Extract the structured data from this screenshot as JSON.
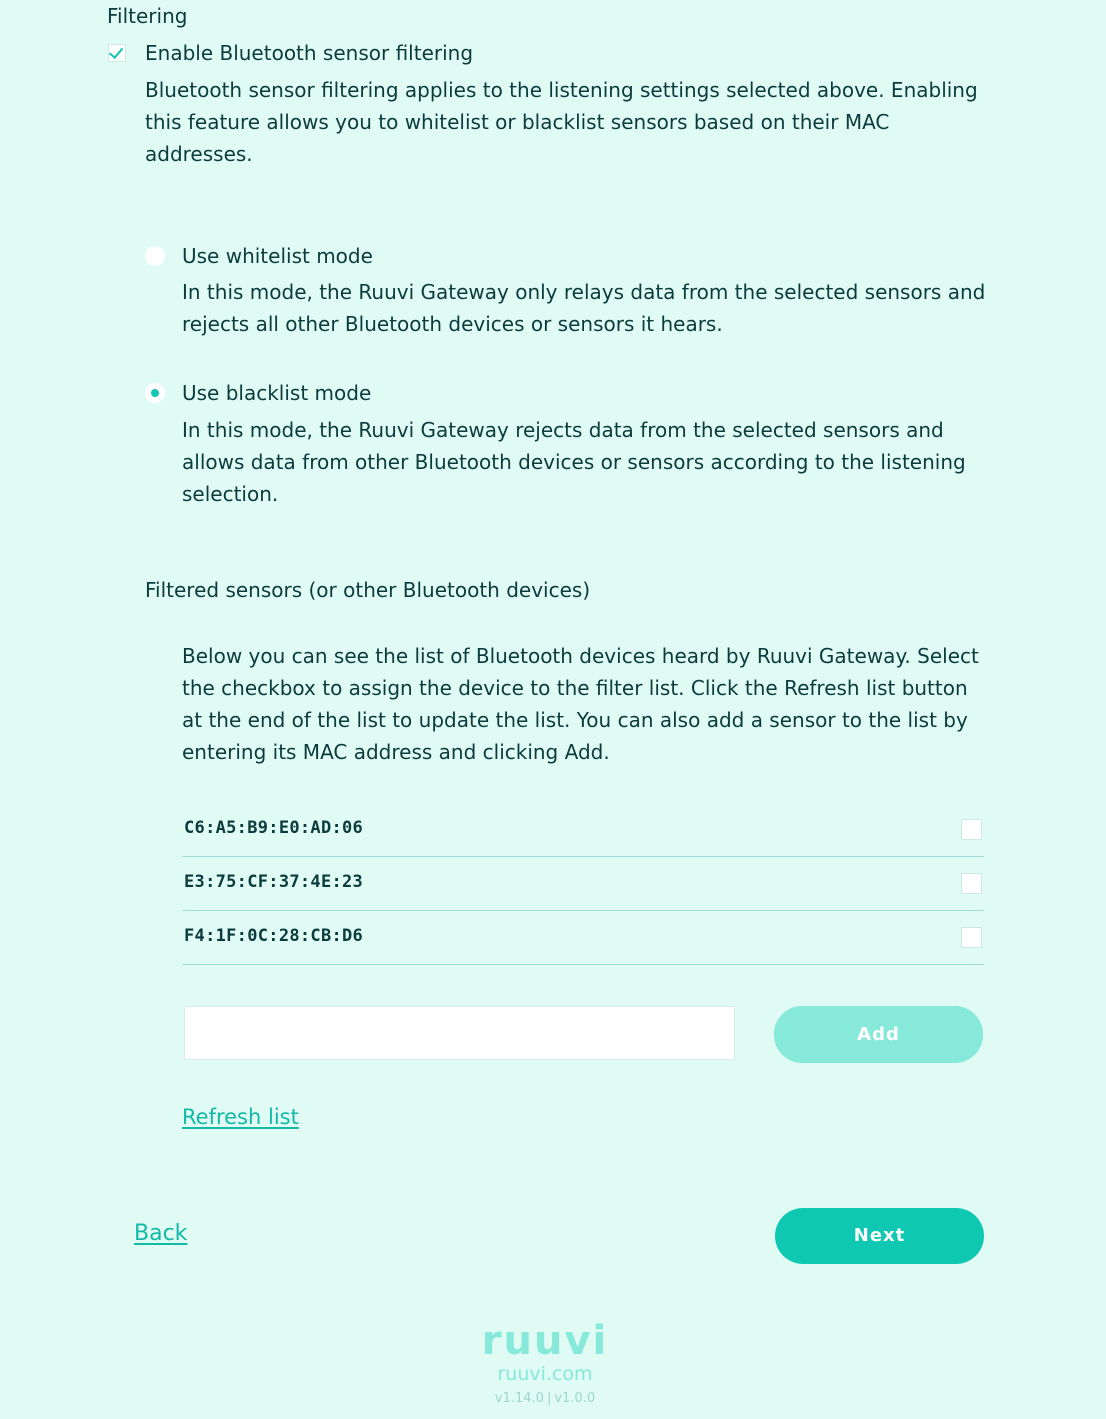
{
  "filtering": {
    "title": "Filtering",
    "enable_label": "Enable Bluetooth sensor filtering",
    "enabled": true,
    "description": "Bluetooth sensor filtering applies to the listening settings selected above. Enabling this feature allows you to whitelist or blacklist sensors based on their MAC addresses."
  },
  "modes": {
    "whitelist": {
      "label": "Use whitelist mode",
      "selected": false,
      "description": "In this mode, the Ruuvi Gateway only relays data from the selected sensors and rejects all other Bluetooth devices or sensors it hears."
    },
    "blacklist": {
      "label": "Use blacklist mode",
      "selected": true,
      "description": "In this mode, the Ruuvi Gateway rejects data from the selected sensors and allows data from other Bluetooth devices or sensors according to the listening selection."
    }
  },
  "filtered_sensors": {
    "title": "Filtered sensors (or other Bluetooth devices)",
    "description": "Below you can see the list of Bluetooth devices heard by Ruuvi Gateway. Select the checkbox to assign the device to the filter list. Click the Refresh list button at the end of the list to update the list. You can also add a sensor to the list by entering its MAC address and clicking Add.",
    "devices": [
      {
        "mac": "C6:A5:B9:E0:AD:06",
        "checked": false
      },
      {
        "mac": "E3:75:CF:37:4E:23",
        "checked": false
      },
      {
        "mac": "F4:1F:0C:28:CB:D6",
        "checked": false
      }
    ],
    "mac_input_value": "",
    "add_label": "Add",
    "refresh_label": "Refresh list"
  },
  "navigation": {
    "back_label": "Back",
    "next_label": "Next"
  },
  "footer": {
    "logo": "ruuvi",
    "site": "ruuvi.com",
    "version_left": "v1.14.0",
    "version_sep": "|",
    "version_right": "v1.0.0"
  },
  "colors": {
    "background": "#dffbf4",
    "accent": "#0ec8b1",
    "accent_light": "#86e9d9",
    "text": "#0b3b3d"
  }
}
